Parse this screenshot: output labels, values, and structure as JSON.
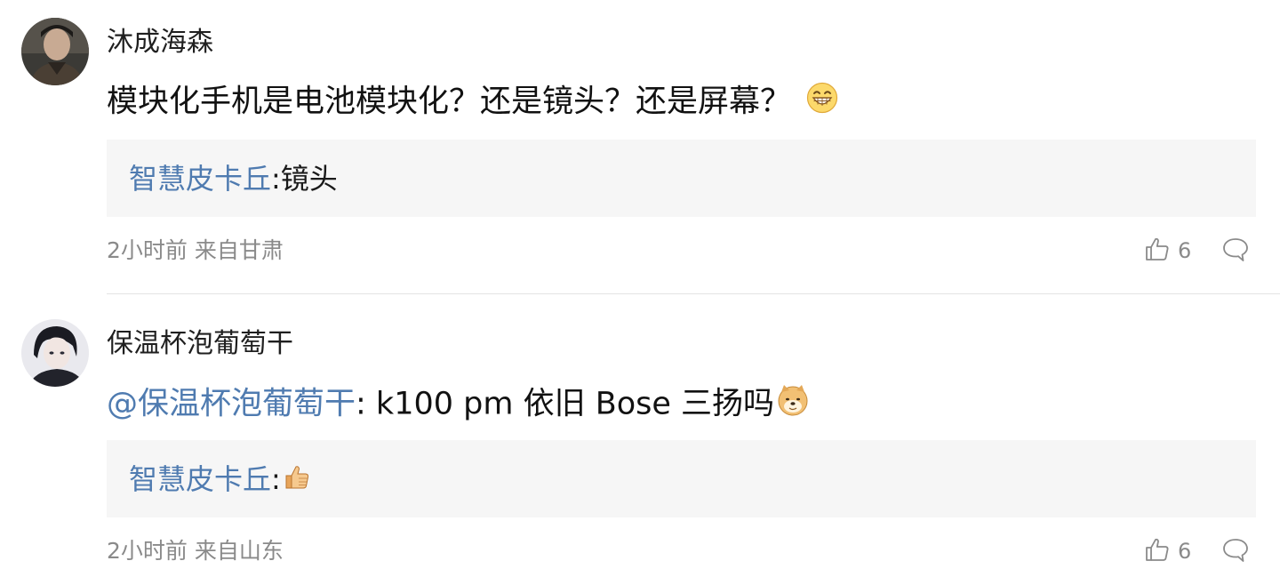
{
  "comments": [
    {
      "username": "沐成海森",
      "content_text": "模块化手机是电池模块化？还是镜头？还是屏幕？",
      "content_emoji": "grin-emoji",
      "reply": {
        "user": "智慧皮卡丘",
        "separator": ":",
        "text": "镜头"
      },
      "meta": "2小时前 来自甘肃",
      "likes": "6"
    },
    {
      "username": "保温杯泡葡萄干",
      "mention": "@保温杯泡葡萄干",
      "content_text": ": k100 pm 依旧 Bose 三扬吗",
      "content_emoji": "doge-emoji",
      "reply": {
        "user": "智慧皮卡丘",
        "separator": ":",
        "emoji": "thumbs-up-emoji"
      },
      "meta": "2小时前 来自山东",
      "likes": "6"
    }
  ],
  "icons": {
    "like": "thumbs-up-outline-icon",
    "reply": "speech-bubble-icon"
  },
  "colors": {
    "link": "#4f7bb0",
    "meta": "#8a8a8a",
    "reply_bg": "#f6f6f6",
    "divider": "#e4e4e4"
  }
}
